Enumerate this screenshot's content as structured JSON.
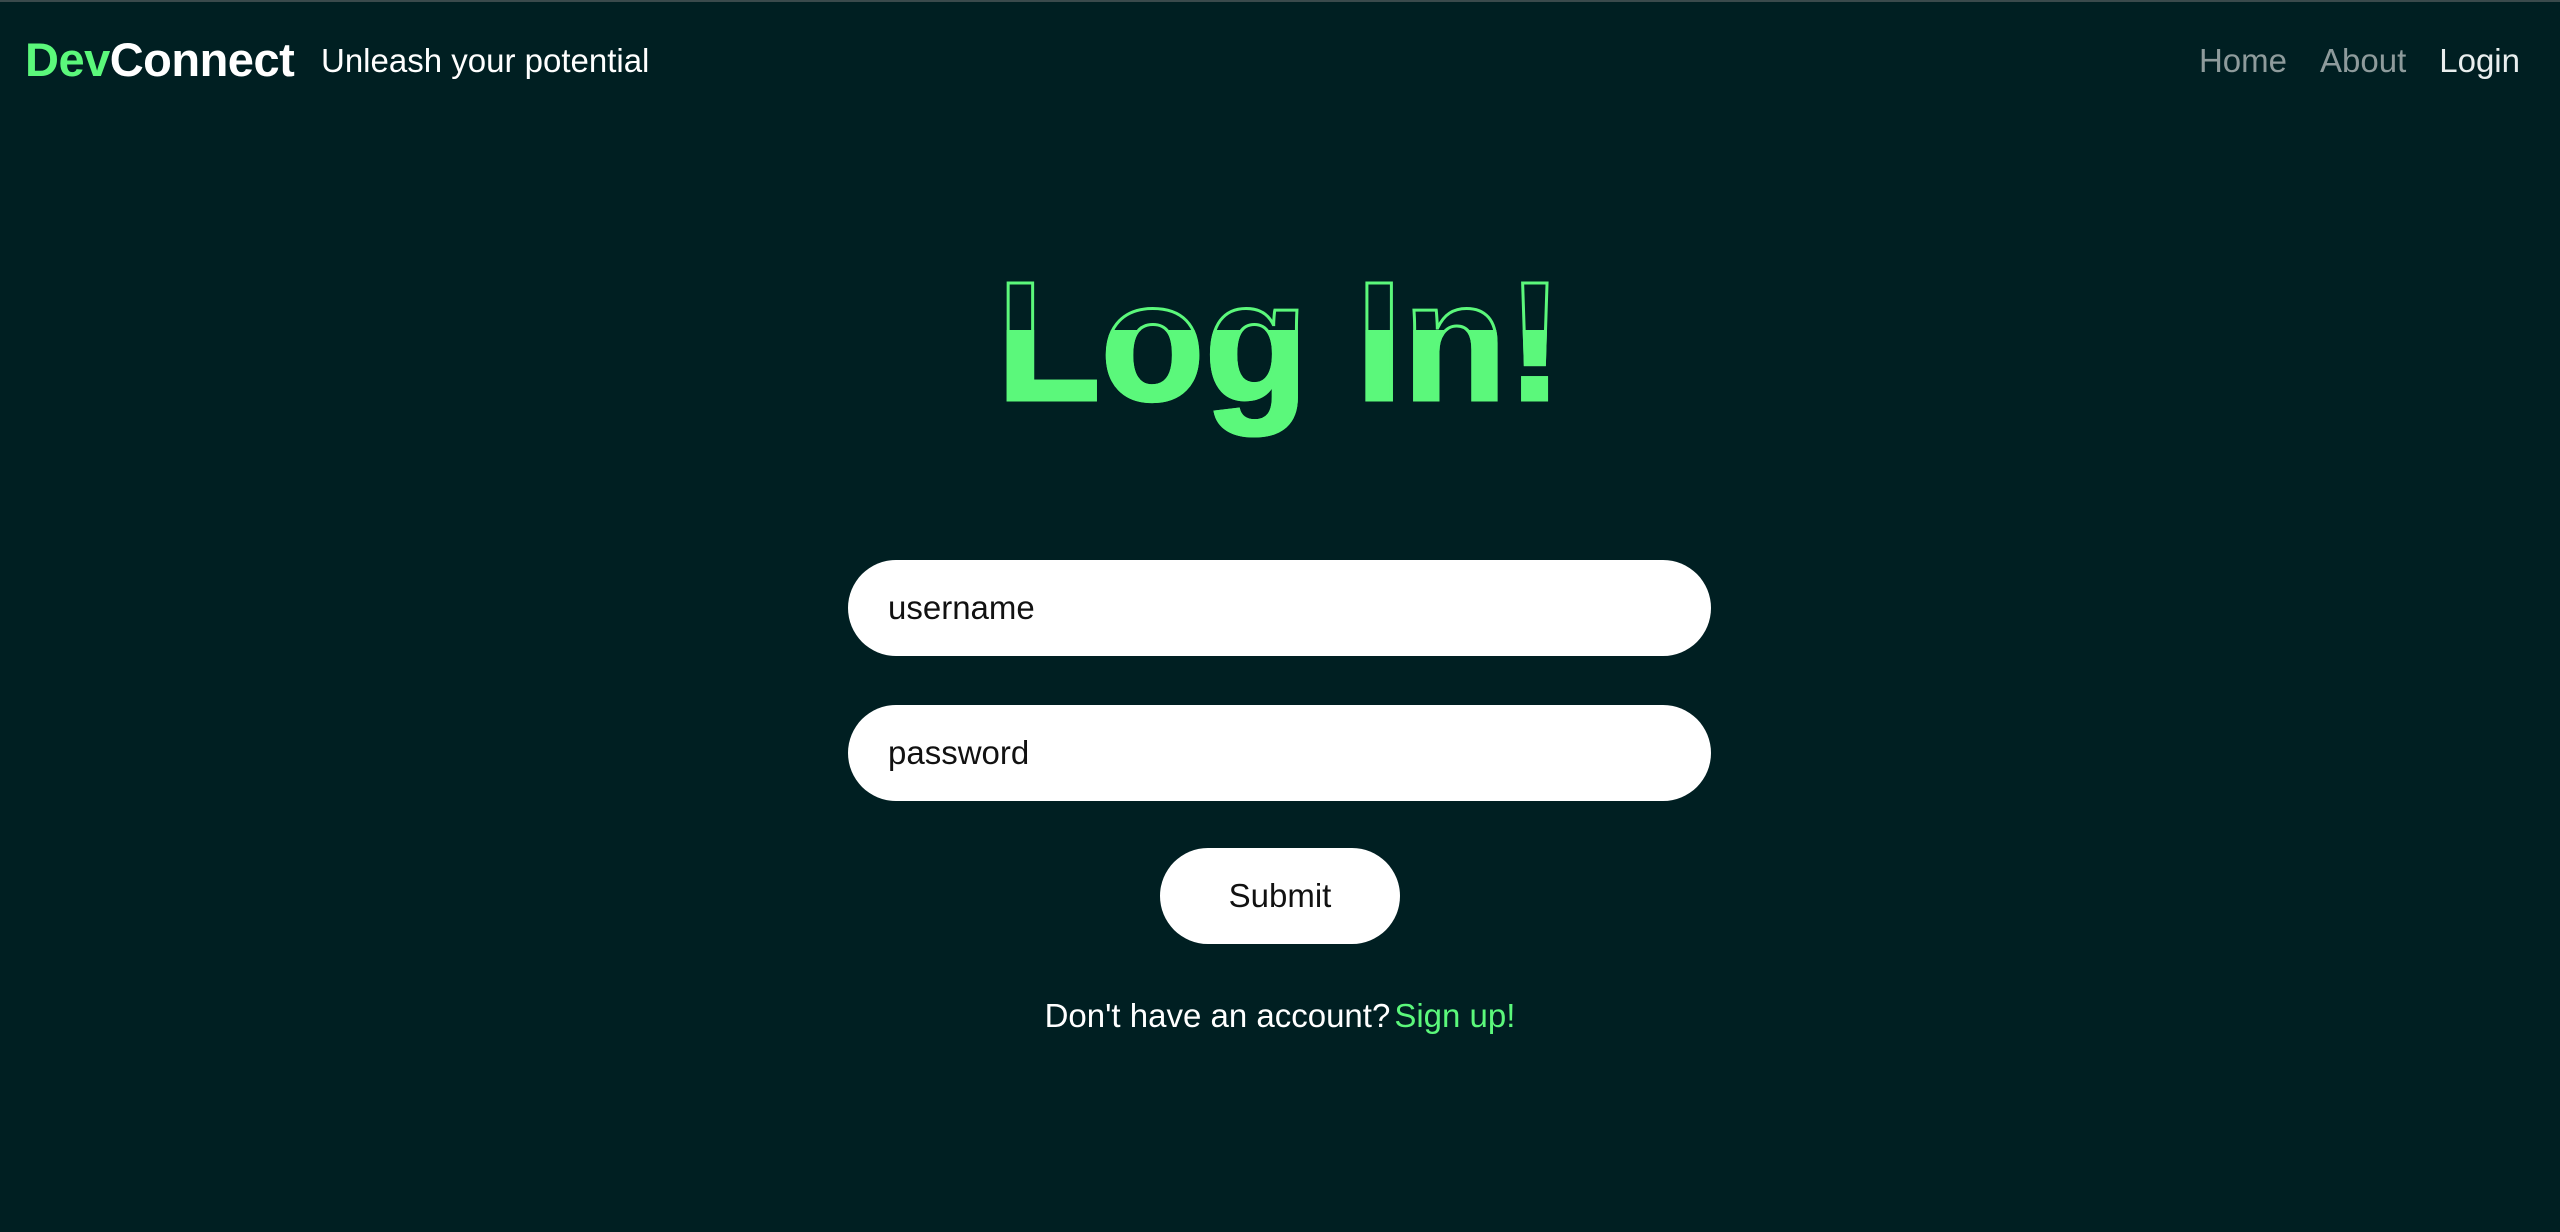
{
  "navbar": {
    "brand_primary": "Dev",
    "brand_secondary": "Connect",
    "tagline": "Unleash your potential",
    "links": [
      {
        "label": "Home",
        "active": false
      },
      {
        "label": "About",
        "active": false
      },
      {
        "label": "Login",
        "active": true
      }
    ]
  },
  "login": {
    "title": "Log In!",
    "username_placeholder": "username",
    "password_placeholder": "password",
    "submit_label": "Submit",
    "signup_prompt": "Don't have an account?",
    "signup_link": "Sign up!"
  },
  "colors": {
    "background": "#001f22",
    "accent": "#5bf87b",
    "nav_inactive": "#8e9b9c",
    "nav_active": "#e9eeee",
    "field_background": "#ffffff"
  }
}
